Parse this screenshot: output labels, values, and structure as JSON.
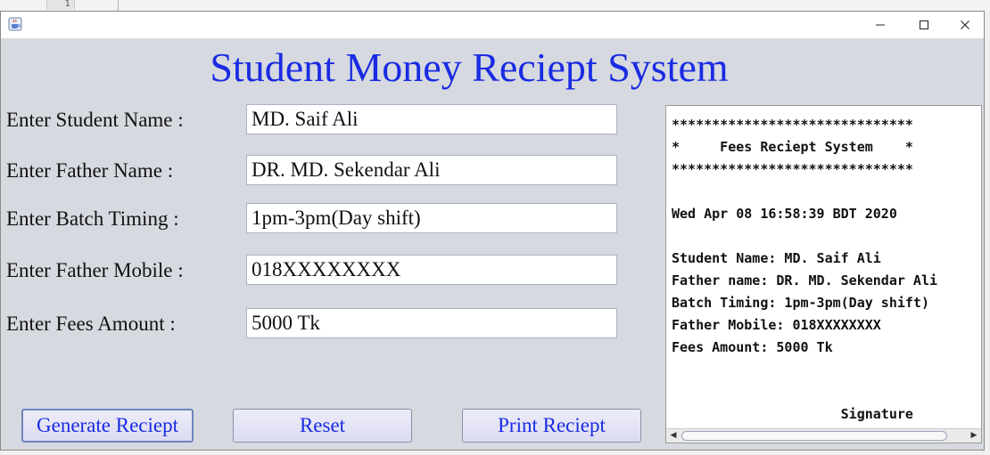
{
  "background": {
    "gutter_line_number": "1"
  },
  "window": {
    "icon": "java-cup-icon",
    "controls": {
      "minimize": "minimize-icon",
      "maximize": "maximize-icon",
      "close": "close-icon"
    }
  },
  "app_title": "Student Money Reciept System",
  "form": {
    "fields": [
      {
        "label": "Enter Student Name :",
        "value": "MD. Saif Ali"
      },
      {
        "label": "Enter Father Name :",
        "value": "DR. MD. Sekendar Ali"
      },
      {
        "label": "Enter Batch Timing :",
        "value": "1pm-3pm(Day shift)"
      },
      {
        "label": "Enter Father Mobile :",
        "value": "018XXXXXXXX"
      },
      {
        "label": "Enter Fees Amount :",
        "value": "5000 Tk"
      }
    ]
  },
  "buttons": {
    "generate": "Generate Reciept",
    "reset": "Reset",
    "print": "Print Reciept"
  },
  "receipt": {
    "text": "******************************\n*     Fees Reciept System    *\n******************************\n\nWed Apr 08 16:58:39 BDT 2020\n\nStudent Name: MD. Saif Ali\nFather name: DR. MD. Sekendar Ali\nBatch Timing: 1pm-3pm(Day shift)\nFather Mobile: 018XXXXXXXX\nFees Amount: 5000 Tk\n\n\n                     Signature"
  },
  "colors": {
    "title_blue": "#1a2be3",
    "window_bg": "#d6d9df"
  }
}
